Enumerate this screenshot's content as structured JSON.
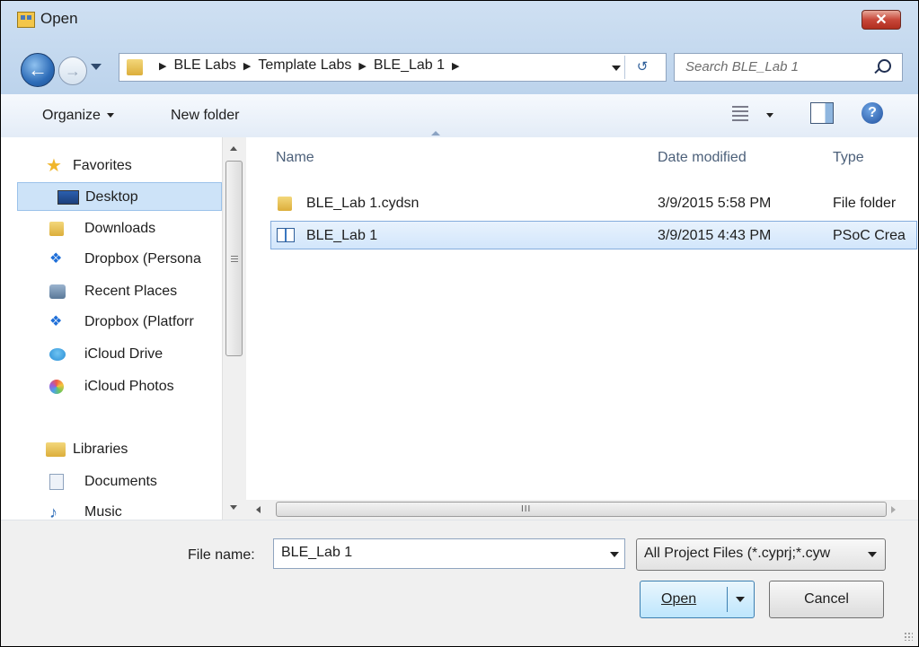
{
  "window": {
    "title": "Open",
    "close_glyph": "✕"
  },
  "nav_bar": {
    "back_glyph": "←",
    "forward_glyph": "→",
    "breadcrumbs": [
      "BLE Labs",
      "Template Labs",
      "BLE_Lab 1"
    ],
    "refresh_glyph": "↺",
    "search_placeholder": "Search BLE_Lab 1"
  },
  "toolbar": {
    "organize_label": "Organize",
    "new_folder_label": "New folder",
    "help_glyph": "?"
  },
  "sidebar": {
    "items": [
      {
        "label": "Favorites",
        "icon": "star-icon"
      },
      {
        "label": "Desktop",
        "icon": "desktop-icon"
      },
      {
        "label": "Downloads",
        "icon": "downloads-icon"
      },
      {
        "label": "Dropbox (Persona",
        "icon": "dropbox-icon"
      },
      {
        "label": "Recent Places",
        "icon": "recent-places-icon"
      },
      {
        "label": "Dropbox (Platforr",
        "icon": "dropbox-icon"
      },
      {
        "label": "iCloud Drive",
        "icon": "icloud-drive-icon"
      },
      {
        "label": "iCloud Photos",
        "icon": "icloud-photos-icon"
      },
      {
        "label": "Libraries",
        "icon": "libraries-icon"
      },
      {
        "label": "Documents",
        "icon": "documents-icon"
      },
      {
        "label": "Music",
        "icon": "music-icon"
      }
    ]
  },
  "file_list": {
    "columns": [
      "Name",
      "Date modified",
      "Type"
    ],
    "rows": [
      {
        "name": "BLE_Lab 1.cydsn",
        "date": "3/9/2015 5:58 PM",
        "type": "File folder",
        "icon": "folder-icon"
      },
      {
        "name": "BLE_Lab 1",
        "date": "3/9/2015 4:43 PM",
        "type": "PSoC Crea",
        "icon": "project-file-icon"
      }
    ],
    "hscroll_grip": "III"
  },
  "bottom": {
    "file_name_label": "File name:",
    "file_name_value": "BLE_Lab 1",
    "filter_value": "All Project Files (*.cyprj;*.cyw",
    "open_label": "Open",
    "cancel_label": "Cancel"
  },
  "colors": {
    "selection": "#cde3f8",
    "accent": "#3c7fb1",
    "close": "#c8483a"
  }
}
